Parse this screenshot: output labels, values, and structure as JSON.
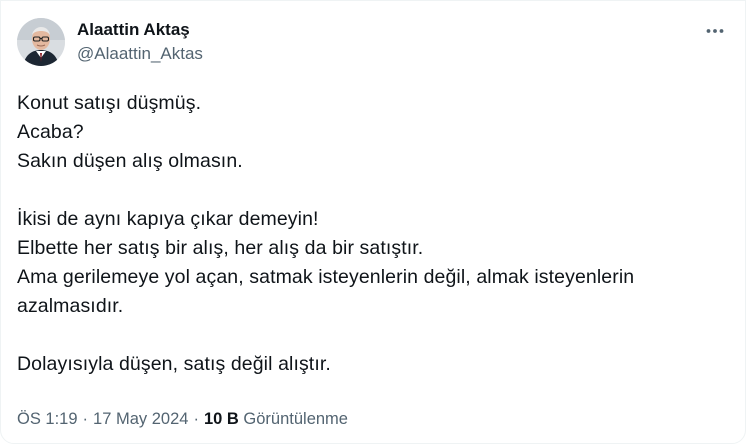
{
  "author": {
    "display_name": "Alaattin Aktaş",
    "handle": "@Alaattin_Aktas"
  },
  "icons": {
    "more": "more-horizontal-icon"
  },
  "tweet": {
    "lines": [
      "Konut satışı düşmüş.",
      "Acaba?",
      "Sakın düşen alış olmasın.",
      "",
      "İkisi de aynı kapıya çıkar demeyin!",
      "Elbette her satış bir alış, her alış da bir satıştır.",
      "Ama gerilemeye yol açan, satmak isteyenlerin değil, almak isteyenlerin",
      "azalmasıdır.",
      "",
      "Dolayısıyla düşen, satış değil alıştır."
    ]
  },
  "meta": {
    "time": "ÖS 1:19",
    "separator": "·",
    "date": "17 May 2024",
    "views_count": "10 B",
    "views_label": "Görüntülenme"
  },
  "colors": {
    "text_primary": "#0f1419",
    "text_secondary": "#536471",
    "border": "#eff3f4"
  }
}
